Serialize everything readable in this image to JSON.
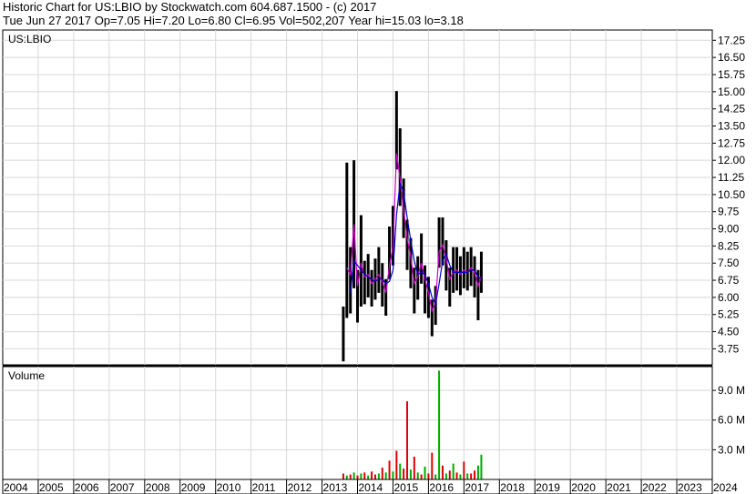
{
  "header": {
    "line1": "Historic Chart for US:LBIO by Stockwatch.com 604.687.1500 - (c) 2017",
    "line2": "Tue Jun 27 2017  Op=7.05  Hi=7.20  Lo=6.80  Cl=6.95  Vol=502,207  Year hi=15.03  lo=3.18"
  },
  "chart_data": [
    {
      "type": "line",
      "subtype": "ohlc-price-bars-with-moving-averages",
      "symbol_label": "US:LBIO",
      "y_ticks": [
        "17.25",
        "16.50",
        "15.75",
        "15.00",
        "14.25",
        "13.50",
        "12.75",
        "12.00",
        "11.25",
        "10.50",
        "9.75",
        "9.00",
        "8.25",
        "7.50",
        "6.75",
        "6.00",
        "5.25",
        "4.50",
        "3.75"
      ],
      "ylim": [
        3.05,
        17.7
      ],
      "x": [
        "2013.60",
        "2013.70",
        "2013.80",
        "2013.90",
        "2014.00",
        "2014.10",
        "2014.20",
        "2014.30",
        "2014.40",
        "2014.50",
        "2014.60",
        "2014.70",
        "2014.80",
        "2014.90",
        "2015.00",
        "2015.10",
        "2015.20",
        "2015.30",
        "2015.40",
        "2015.50",
        "2015.60",
        "2015.70",
        "2015.80",
        "2015.90",
        "2016.00",
        "2016.10",
        "2016.20",
        "2016.30",
        "2016.40",
        "2016.50",
        "2016.60",
        "2016.70",
        "2016.80",
        "2016.90",
        "2017.00",
        "2017.10",
        "2017.20",
        "2017.30",
        "2017.40",
        "2017.49"
      ],
      "series": [
        {
          "name": "price",
          "color": "#000000",
          "values": [
            4.2,
            9.5,
            6.8,
            11.0,
            5.2,
            8.8,
            6.6,
            7.0,
            6.3,
            6.8,
            7.2,
            6.4,
            5.7,
            8.0,
            8.6,
            13.8,
            12.0,
            10.0,
            8.4,
            7.6,
            6.2,
            6.9,
            7.8,
            6.5,
            6.0,
            5.1,
            5.6,
            8.3,
            8.6,
            7.6,
            6.4,
            7.3,
            7.2,
            6.9,
            7.3,
            7.1,
            7.4,
            7.1,
            6.3,
            7.2
          ],
          "low": [
            3.2,
            5.1,
            5.3,
            6.4,
            4.9,
            5.6,
            5.7,
            6.0,
            5.6,
            5.9,
            6.2,
            5.6,
            5.2,
            6.8,
            7.4,
            11.6,
            10.0,
            8.6,
            7.2,
            6.4,
            5.3,
            5.9,
            6.6,
            5.3,
            5.1,
            4.3,
            4.8,
            7.3,
            7.4,
            6.3,
            5.6,
            6.2,
            6.3,
            6.1,
            6.4,
            6.3,
            6.5,
            6.0,
            5.0,
            6.2
          ],
          "high": [
            5.6,
            11.9,
            8.2,
            12.0,
            7.2,
            9.6,
            7.6,
            7.9,
            7.2,
            7.7,
            8.2,
            7.5,
            6.8,
            9.1,
            10.0,
            15.03,
            13.4,
            11.2,
            9.4,
            8.6,
            7.3,
            7.8,
            8.8,
            7.4,
            6.9,
            5.9,
            6.5,
            9.5,
            9.5,
            8.5,
            7.3,
            8.2,
            8.2,
            7.8,
            8.2,
            8.0,
            8.2,
            7.8,
            7.2,
            8.0
          ]
        },
        {
          "name": "ma-short",
          "color": "#cc00cc",
          "values": [
            null,
            7.3,
            7.0,
            9.2,
            6.5,
            7.5,
            6.9,
            7.0,
            6.6,
            6.8,
            7.0,
            6.7,
            6.2,
            7.4,
            8.2,
            12.3,
            11.2,
            9.8,
            8.6,
            7.8,
            6.6,
            6.9,
            7.5,
            6.8,
            6.2,
            5.4,
            5.8,
            8.0,
            8.3,
            7.7,
            6.8,
            7.1,
            7.2,
            7.0,
            7.2,
            7.1,
            7.3,
            7.1,
            6.5,
            6.9
          ]
        },
        {
          "name": "ma-long",
          "color": "#0000cc",
          "values": [
            null,
            null,
            6.2,
            7.6,
            7.4,
            7.2,
            7.0,
            6.9,
            6.8,
            6.7,
            6.8,
            6.8,
            6.6,
            6.7,
            7.2,
            9.6,
            11.0,
            10.6,
            9.5,
            8.5,
            7.6,
            7.0,
            7.1,
            7.0,
            6.6,
            6.0,
            5.7,
            6.6,
            7.6,
            7.9,
            7.4,
            7.1,
            7.1,
            7.1,
            7.1,
            7.1,
            7.2,
            7.2,
            6.9,
            6.8
          ]
        }
      ]
    },
    {
      "type": "bar",
      "title": "Volume",
      "y_ticks": [
        "9.0 M",
        "6.0 M",
        "3.0 M"
      ],
      "ylim": [
        0,
        11.4
      ],
      "unit": "M",
      "x": [
        "2013.60",
        "2013.70",
        "2013.80",
        "2013.90",
        "2014.00",
        "2014.10",
        "2014.20",
        "2014.30",
        "2014.40",
        "2014.50",
        "2014.60",
        "2014.70",
        "2014.80",
        "2014.90",
        "2015.00",
        "2015.10",
        "2015.20",
        "2015.30",
        "2015.40",
        "2015.50",
        "2015.60",
        "2015.70",
        "2015.80",
        "2015.90",
        "2016.00",
        "2016.10",
        "2016.20",
        "2016.30",
        "2016.40",
        "2016.50",
        "2016.60",
        "2016.70",
        "2016.80",
        "2016.90",
        "2017.00",
        "2017.10",
        "2017.20",
        "2017.30",
        "2017.40",
        "2017.49"
      ],
      "series": [
        {
          "name": "volume",
          "values": [
            0.6,
            0.4,
            0.5,
            0.7,
            0.4,
            0.6,
            0.7,
            0.4,
            0.8,
            0.5,
            0.6,
            1.2,
            0.7,
            1.9,
            0.8,
            2.9,
            1.6,
            1.1,
            7.9,
            1.0,
            2.3,
            0.7,
            0.5,
            1.3,
            0.6,
            2.7,
            0.5,
            11.0,
            1.4,
            0.6,
            0.9,
            1.6,
            0.7,
            0.5,
            1.8,
            0.6,
            0.6,
            0.9,
            1.4,
            2.5
          ],
          "direction": [
            "down",
            "up",
            "down",
            "up",
            "down",
            "up",
            "down",
            "up",
            "down",
            "down",
            "up",
            "down",
            "up",
            "down",
            "up",
            "down",
            "up",
            "down",
            "down",
            "up",
            "down",
            "up",
            "down",
            "up",
            "down",
            "down",
            "up",
            "up",
            "down",
            "up",
            "down",
            "up",
            "down",
            "up",
            "down",
            "up",
            "down",
            "down",
            "up",
            "up"
          ]
        }
      ],
      "colors": {
        "up": "#00aa00",
        "down": "#dd0000"
      }
    }
  ],
  "x_axis": {
    "labels": [
      "2004",
      "2005",
      "2006",
      "2007",
      "2008",
      "2009",
      "2010",
      "2011",
      "2012",
      "2013",
      "2014",
      "2015",
      "2016",
      "2017",
      "2018",
      "2019",
      "2020",
      "2021",
      "2022",
      "2023",
      "2024"
    ]
  }
}
